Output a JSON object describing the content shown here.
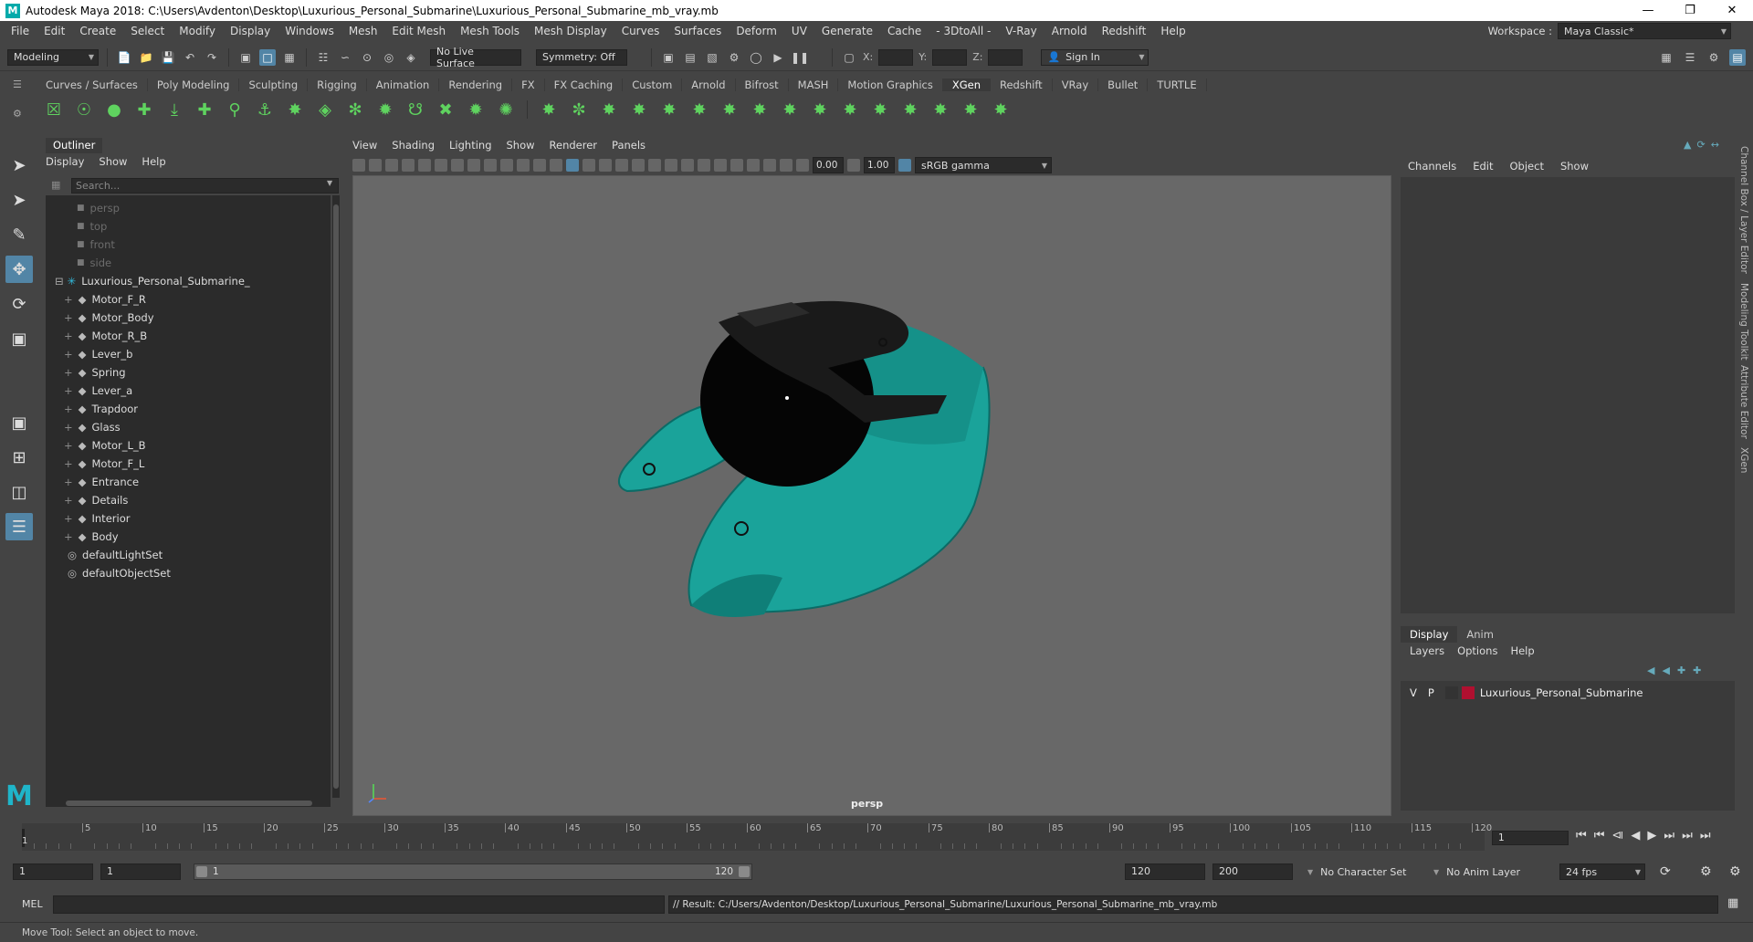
{
  "window": {
    "title": "Autodesk Maya 2018: C:\\Users\\Avdenton\\Desktop\\Luxurious_Personal_Submarine\\Luxurious_Personal_Submarine_mb_vray.mb"
  },
  "menubar": [
    "File",
    "Edit",
    "Create",
    "Select",
    "Modify",
    "Display",
    "Windows",
    "Mesh",
    "Edit Mesh",
    "Mesh Tools",
    "Mesh Display",
    "Curves",
    "Surfaces",
    "Deform",
    "UV",
    "Generate",
    "Cache",
    "- 3DtoAll -",
    "V-Ray",
    "Arnold",
    "Redshift",
    "Help"
  ],
  "workspace": {
    "label": "Workspace :",
    "value": "Maya Classic*"
  },
  "status": {
    "mode": "Modeling",
    "live_surface": "No Live Surface",
    "symmetry": "Symmetry: Off",
    "x_label": "X:",
    "y_label": "Y:",
    "z_label": "Z:",
    "sign_in": "Sign In"
  },
  "shelf_tabs": [
    "Curves / Surfaces",
    "Poly Modeling",
    "Sculpting",
    "Rigging",
    "Animation",
    "Rendering",
    "FX",
    "FX Caching",
    "Custom",
    "Arnold",
    "Bifrost",
    "MASH",
    "Motion Graphics",
    "XGen",
    "Redshift",
    "VRay",
    "Bullet",
    "TURTLE"
  ],
  "shelf_active": "XGen",
  "outliner": {
    "tab": "Outliner",
    "menu": [
      "Display",
      "Show",
      "Help"
    ],
    "search_placeholder": "Search...",
    "cameras": [
      "persp",
      "top",
      "front",
      "side"
    ],
    "root": "Luxurious_Personal_Submarine_",
    "children": [
      "Motor_F_R",
      "Motor_Body",
      "Motor_R_B",
      "Lever_b",
      "Spring",
      "Lever_a",
      "Trapdoor",
      "Glass",
      "Motor_L_B",
      "Motor_F_L",
      "Entrance",
      "Details",
      "Interior",
      "Body"
    ],
    "sets": [
      "defaultLightSet",
      "defaultObjectSet"
    ]
  },
  "viewport": {
    "menu": [
      "View",
      "Shading",
      "Lighting",
      "Show",
      "Renderer",
      "Panels"
    ],
    "exposure": "0.00",
    "gamma": "1.00",
    "color_space": "sRGB gamma",
    "camera_label": "persp"
  },
  "channel_box": {
    "menu": [
      "Channels",
      "Edit",
      "Object",
      "Show"
    ]
  },
  "layer_editor": {
    "tabs": [
      "Display",
      "Anim"
    ],
    "menu": [
      "Layers",
      "Options",
      "Help"
    ],
    "layer": {
      "v": "V",
      "p": "P",
      "name": "Luxurious_Personal_Submarine",
      "color": "#b01030"
    }
  },
  "side_tabs": [
    "Channel Box / Layer Editor",
    "Modeling Toolkit",
    "Attribute Editor",
    "XGen"
  ],
  "timeline": {
    "ticks": [
      "1",
      "5",
      "10",
      "15",
      "20",
      "25",
      "30",
      "35",
      "40",
      "45",
      "50",
      "55",
      "60",
      "65",
      "70",
      "75",
      "80",
      "85",
      "90",
      "95",
      "100",
      "105",
      "110",
      "115",
      "120"
    ],
    "current_frame": "1"
  },
  "range": {
    "start": "1",
    "playback_start": "1",
    "slider_start": "1",
    "slider_end": "120",
    "playback_end": "120",
    "end": "200",
    "character_set": "No Character Set",
    "anim_layer": "No Anim Layer",
    "fps": "24 fps"
  },
  "command": {
    "lang": "MEL",
    "result": "// Result: C:/Users/Avdenton/Desktop/Luxurious_Personal_Submarine/Luxurious_Personal_Submarine_mb_vray.mb"
  },
  "help_line": "Move Tool: Select an object to move.",
  "colors": {
    "accent": "#5285a6",
    "submarine": "#1aa39a",
    "shelf_green": "#5fd35f"
  }
}
